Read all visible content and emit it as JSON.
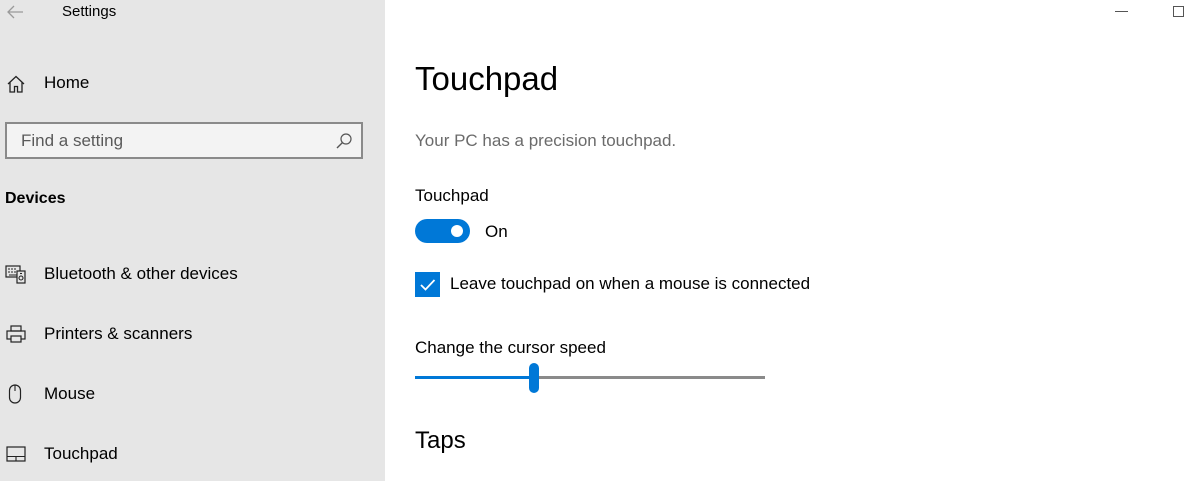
{
  "window": {
    "title": "Settings"
  },
  "sidebar": {
    "home_label": "Home",
    "search": {
      "placeholder": "Find a setting",
      "value": ""
    },
    "section_label": "Devices",
    "items": [
      {
        "label": "Bluetooth & other devices",
        "icon": "bluetooth-devices-icon"
      },
      {
        "label": "Printers & scanners",
        "icon": "printer-icon"
      },
      {
        "label": "Mouse",
        "icon": "mouse-icon"
      },
      {
        "label": "Touchpad",
        "icon": "touchpad-icon"
      }
    ]
  },
  "main": {
    "title": "Touchpad",
    "subtitle": "Your PC has a precision touchpad.",
    "touchpad_toggle": {
      "label": "Touchpad",
      "on": true,
      "state_label": "On"
    },
    "mouse_checkbox": {
      "checked": true,
      "label": "Leave touchpad on when a mouse is connected"
    },
    "cursor_speed": {
      "label": "Change the cursor speed",
      "value_fraction": 0.34
    },
    "taps_heading": "Taps"
  },
  "colors": {
    "accent": "#0078d7",
    "sidebar_bg": "#e6e6e6",
    "subtitle_text": "#6b6b6b"
  }
}
